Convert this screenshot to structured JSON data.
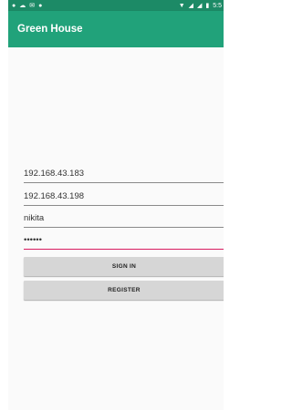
{
  "status_bar": {
    "time": "5:5",
    "left_icons": [
      "location-icon",
      "cloud-icon",
      "mail-icon",
      "location-icon"
    ],
    "right_icons": [
      "wifi-icon",
      "signal-icon",
      "signal-icon",
      "battery-icon"
    ]
  },
  "app_bar": {
    "title": "Green House"
  },
  "form": {
    "ip1": "192.168.43.183",
    "ip2": "192.168.43.198",
    "username": "nikita",
    "password": "••••••"
  },
  "buttons": {
    "sign_in": "SIGN IN",
    "register": "REGISTER"
  },
  "colors": {
    "status_bar": "#1c8a66",
    "app_bar": "#21a27a",
    "accent": "#d81b60"
  }
}
